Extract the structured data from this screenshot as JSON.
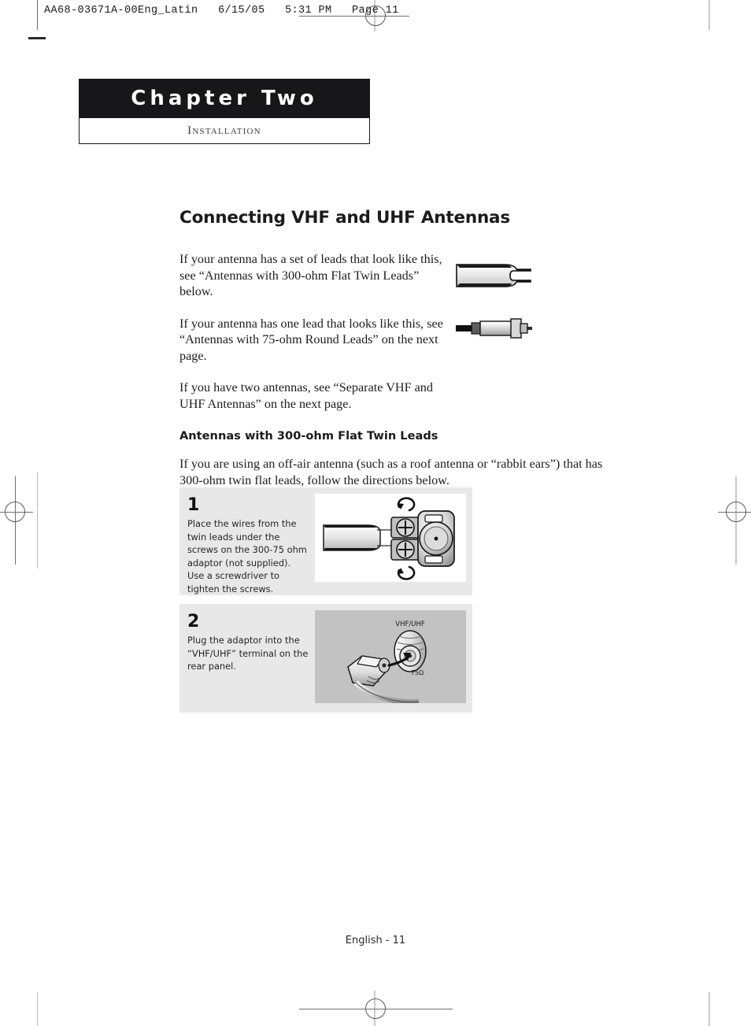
{
  "print_slug": "AA68-03671A-00Eng_Latin   6/15/05   5:31 PM   Page 11",
  "chapter": {
    "title": "Chapter Two",
    "subtitle": "Installation"
  },
  "section": {
    "title": "Connecting VHF and UHF Antennas",
    "paragraphs": [
      "If your antenna has a set of leads that look like this, see “Antennas with 300-ohm Flat Twin Leads” below.",
      "If your antenna has one lead that looks like this, see “Antennas with 75-ohm Round Leads” on the next page.",
      "If you have two antennas, see “Separate VHF and UHF Antennas” on the next page."
    ]
  },
  "subsection": {
    "title": "Antennas with 300-ohm Flat Twin Leads",
    "intro": "If you are using an off-air antenna (such as a roof antenna or “rabbit ears”) that has 300-ohm twin flat leads, follow the directions below."
  },
  "lead_figures": [
    {
      "name": "flat-twin-lead-cable"
    },
    {
      "name": "round-coaxial-lead-connector"
    }
  ],
  "steps": [
    {
      "number": "1",
      "text": "Place the wires from the twin leads under the screws on the 300-75 ohm adaptor (not supplied). Use a screwdriver to tighten the screws.",
      "figure": "adaptor-screw-terminals-diagram",
      "figure_background": "#ffffff"
    },
    {
      "number": "2",
      "text": "Plug the adaptor into the “VHF/UHF” terminal on the rear panel.",
      "figure": "rear-panel-vhf-uhf-terminal-diagram",
      "figure_background": "#c2c2c2",
      "figure_labels": {
        "terminal": "VHF/UHF",
        "impedance": "75Ω"
      }
    }
  ],
  "footer": "English - 11",
  "colors": {
    "banner_background": "#17171a",
    "banner_text": "#ffffff",
    "step_box_background": "#e8e8e8",
    "body_text": "#1d1d1d"
  }
}
